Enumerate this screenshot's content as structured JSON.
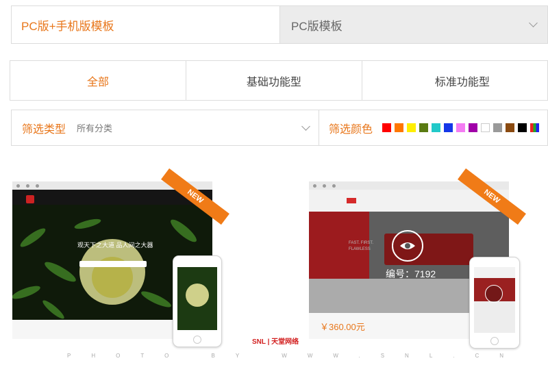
{
  "template_type": {
    "left_label": "PC版+手机版模板",
    "right_label": "PC版模板"
  },
  "tabs": [
    {
      "label": "全部",
      "active": true
    },
    {
      "label": "基础功能型",
      "active": false
    },
    {
      "label": "标准功能型",
      "active": false
    }
  ],
  "filters": {
    "type_label": "筛选类型",
    "type_value": "所有分类",
    "color_label": "筛选颜色",
    "colors": [
      "#ff0000",
      "#ff7700",
      "#ffee00",
      "#5a7b12",
      "#22c9c9",
      "#1437e8",
      "#f47cf3",
      "#a000a8",
      "#ffffff",
      "#9a9a9a",
      "#8a4a10",
      "#000000",
      "multicolor"
    ]
  },
  "products": [
    {
      "badge": "NEW",
      "hero_title": "观天下之大道 品人间之大器"
    },
    {
      "badge": "NEW",
      "hero_title": "FAST. FIRST. FLAWLESS",
      "overlay_label": "编号：7192",
      "price": "￥360.00元"
    }
  ],
  "watermark": {
    "brand": "SNL | 天堂网络",
    "text": "PHOTO BY WWW.SNL.CN"
  },
  "accent_color": "#e8761a"
}
